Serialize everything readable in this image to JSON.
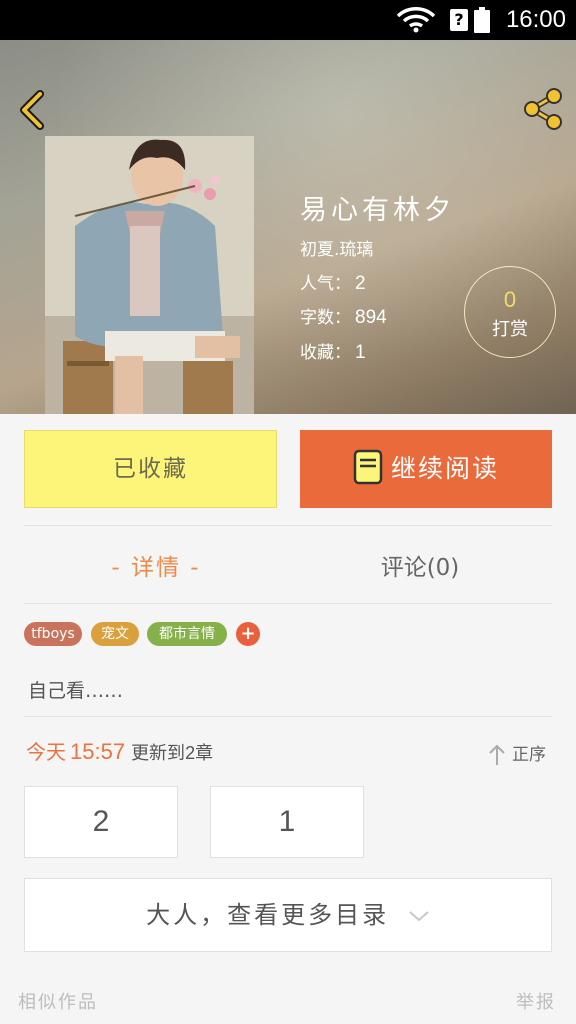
{
  "status_bar": {
    "time": "16:00",
    "sim_label": "?"
  },
  "book": {
    "title": "易心有林夕",
    "author": "初夏.琉璃",
    "popularity_label": "人气：",
    "popularity": "2",
    "word_count_label": "字数：",
    "word_count": "894",
    "favorites_label": "收藏：",
    "favorites": "1",
    "tip_count": "0",
    "tip_label": "打赏"
  },
  "actions": {
    "favorited_label": "已收藏",
    "continue_label": "继续阅读"
  },
  "tabs": {
    "detail": "- 详情 -",
    "comments": "评论(0)"
  },
  "tags": [
    {
      "label": "tfboys",
      "color": "#c9735c"
    },
    {
      "label": "宠文",
      "color": "#d9a03c"
    },
    {
      "label": "都市言情",
      "color": "#86b04a"
    }
  ],
  "tag_add": "+",
  "intro": "自己看……",
  "update": {
    "day": "今天",
    "time": "15:57",
    "prefix": "更新到",
    "count": "2",
    "suffix": "章",
    "order_label": "正序"
  },
  "chapters": [
    "2",
    "1"
  ],
  "more_catalog": "大人，查看更多目录",
  "footer": {
    "similar": "相似作品",
    "report": "举报"
  },
  "colors": {
    "accent": "#ea6a3c",
    "fav": "#fdf57a",
    "tip": "#f5d96b"
  }
}
